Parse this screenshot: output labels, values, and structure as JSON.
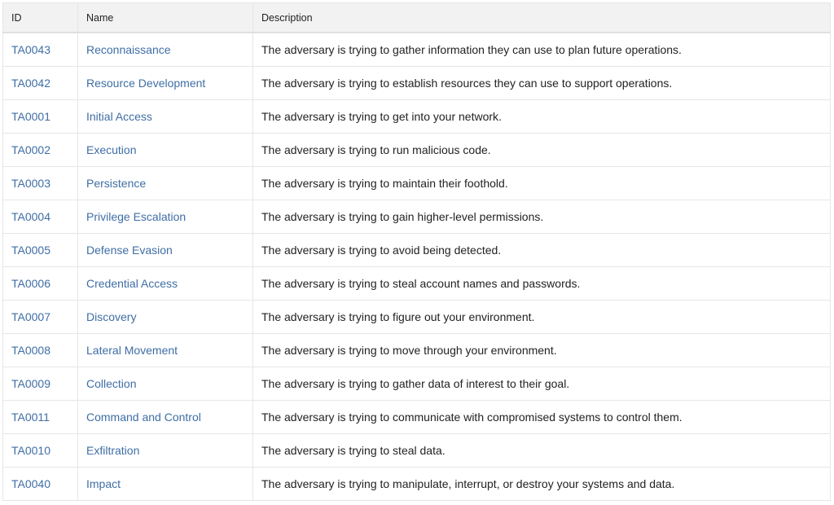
{
  "colors": {
    "link": "#3f6ea5",
    "header_bg": "#f2f2f2"
  },
  "table": {
    "headers": [
      "ID",
      "Name",
      "Description"
    ],
    "rows": [
      {
        "id": "TA0043",
        "name": "Reconnaissance",
        "description": "The adversary is trying to gather information they can use to plan future operations."
      },
      {
        "id": "TA0042",
        "name": "Resource Development",
        "description": "The adversary is trying to establish resources they can use to support operations."
      },
      {
        "id": "TA0001",
        "name": "Initial Access",
        "description": "The adversary is trying to get into your network."
      },
      {
        "id": "TA0002",
        "name": "Execution",
        "description": "The adversary is trying to run malicious code."
      },
      {
        "id": "TA0003",
        "name": "Persistence",
        "description": "The adversary is trying to maintain their foothold."
      },
      {
        "id": "TA0004",
        "name": "Privilege Escalation",
        "description": "The adversary is trying to gain higher-level permissions."
      },
      {
        "id": "TA0005",
        "name": "Defense Evasion",
        "description": "The adversary is trying to avoid being detected."
      },
      {
        "id": "TA0006",
        "name": "Credential Access",
        "description": "The adversary is trying to steal account names and passwords."
      },
      {
        "id": "TA0007",
        "name": "Discovery",
        "description": "The adversary is trying to figure out your environment."
      },
      {
        "id": "TA0008",
        "name": "Lateral Movement",
        "description": "The adversary is trying to move through your environment."
      },
      {
        "id": "TA0009",
        "name": "Collection",
        "description": "The adversary is trying to gather data of interest to their goal."
      },
      {
        "id": "TA0011",
        "name": "Command and Control",
        "description": "The adversary is trying to communicate with compromised systems to control them."
      },
      {
        "id": "TA0010",
        "name": "Exfiltration",
        "description": "The adversary is trying to steal data."
      },
      {
        "id": "TA0040",
        "name": "Impact",
        "description": "The adversary is trying to manipulate, interrupt, or destroy your systems and data."
      }
    ]
  }
}
